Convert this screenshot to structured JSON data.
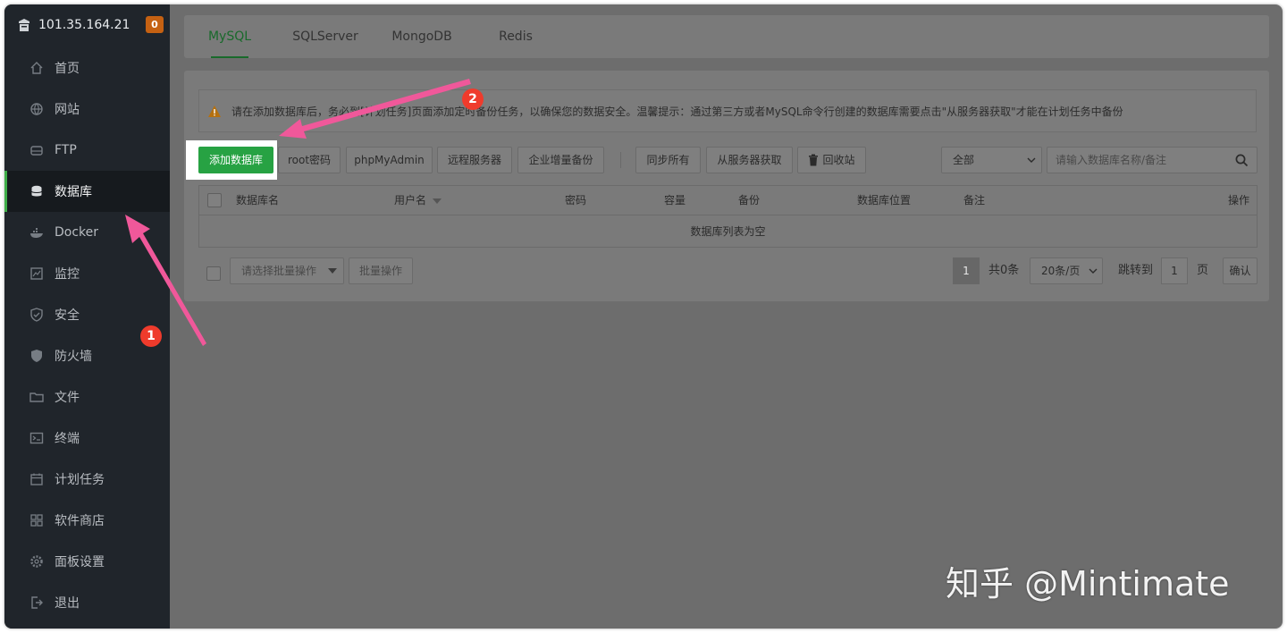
{
  "server": {
    "ip": "101.35.164.21",
    "badge": "0"
  },
  "sidebar": {
    "items": [
      {
        "label": "首页",
        "icon": "home-icon"
      },
      {
        "label": "网站",
        "icon": "globe-icon"
      },
      {
        "label": "FTP",
        "icon": "ftp-icon"
      },
      {
        "label": "数据库",
        "icon": "database-icon",
        "active": true
      },
      {
        "label": "Docker",
        "icon": "docker-icon"
      },
      {
        "label": "监控",
        "icon": "monitor-icon"
      },
      {
        "label": "安全",
        "icon": "shield-icon"
      },
      {
        "label": "防火墙",
        "icon": "firewall-icon"
      },
      {
        "label": "文件",
        "icon": "folder-icon"
      },
      {
        "label": "终端",
        "icon": "terminal-icon"
      },
      {
        "label": "计划任务",
        "icon": "calendar-icon"
      },
      {
        "label": "软件商店",
        "icon": "apps-icon"
      },
      {
        "label": "面板设置",
        "icon": "gear-icon"
      },
      {
        "label": "退出",
        "icon": "logout-icon"
      }
    ]
  },
  "tabs": [
    "MySQL",
    "SQLServer",
    "MongoDB",
    "Redis"
  ],
  "notice": {
    "text": "请在添加数据库后，务必到[计划任务]页面添加定时备份任务，以确保您的数据安全。温馨提示：通过第三方或者MySQL命令行创建的数据库需要点击\"从服务器获取\"才能在计划任务中备份"
  },
  "toolbar": {
    "add_db": "添加数据库",
    "root_pwd": "root密码",
    "phpmyadmin": "phpMyAdmin",
    "remote": "远程服务器",
    "enterprise_backup": "企业增量备份",
    "sync_all": "同步所有",
    "fetch_from_server": "从服务器获取",
    "recycle": "回收站",
    "filter_value": "全部",
    "search_placeholder": "请输入数据库名称/备注"
  },
  "table": {
    "headers": [
      "数据库名",
      "用户名",
      "密码",
      "容量",
      "备份",
      "数据库位置",
      "备注",
      "操作"
    ],
    "empty_text": "数据库列表为空"
  },
  "footer": {
    "batch_placeholder": "请选择批量操作",
    "batch_button": "批量操作",
    "page": "1",
    "total": "共0条",
    "page_size": "20条/页",
    "jump_label": "跳转到",
    "jump_value": "1",
    "page_unit": "页",
    "confirm": "确认"
  },
  "annotations": {
    "marker1": "1",
    "marker2": "2",
    "color": "#f0589a"
  },
  "watermark": "知乎 @Mintimate"
}
